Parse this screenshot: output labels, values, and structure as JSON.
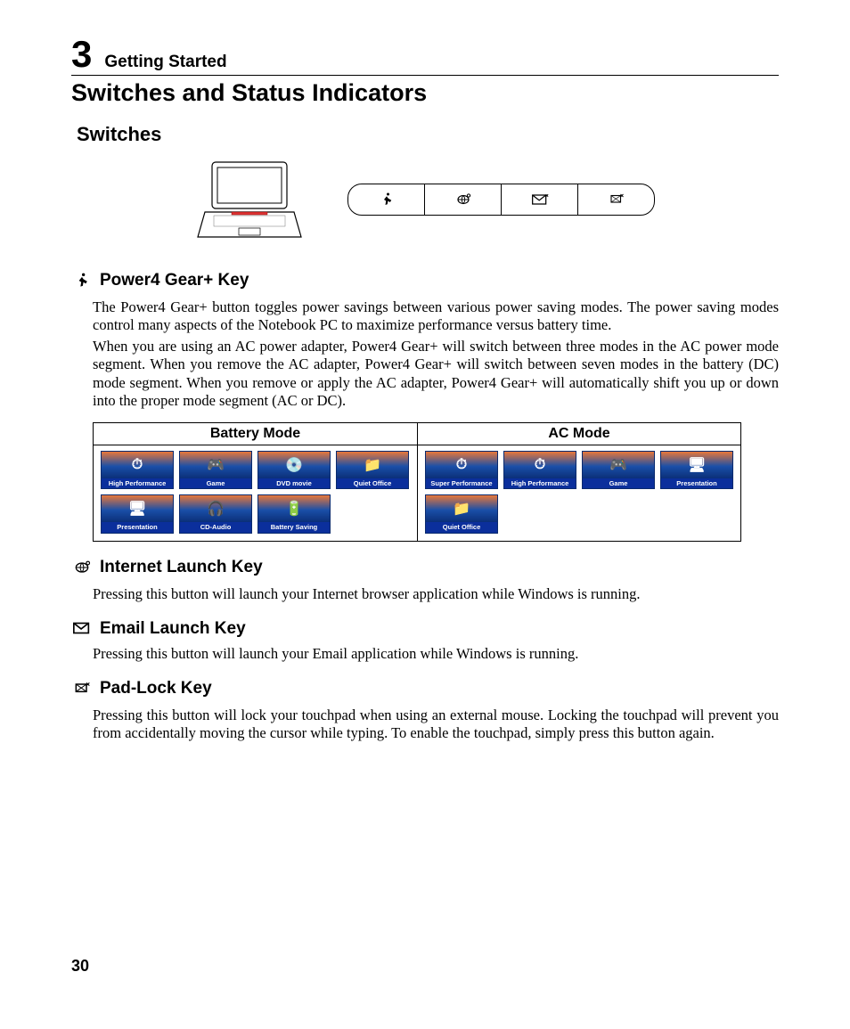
{
  "chapter": {
    "number": "3",
    "title": "Getting Started"
  },
  "pageTitle": "Switches and Status Indicators",
  "switches": {
    "heading": "Switches",
    "bar": [
      "running-man-icon",
      "globe-icon",
      "mail-icon",
      "padlock-icon"
    ]
  },
  "sections": {
    "power4": {
      "title": "Power4 Gear+ Key",
      "p1": "The Power4 Gear+ button toggles power savings between various power saving modes. The power saving modes control many aspects of the Notebook PC to maximize performance versus battery time.",
      "p2": "When you are using an AC power adapter, Power4 Gear+ will switch between three modes in the AC power mode segment. When you remove the AC adapter, Power4 Gear+ will switch between seven modes in the battery (DC) mode segment. When you remove or apply the AC adapter, Power4 Gear+ will automatically shift you up or down into the proper mode segment (AC or DC)."
    },
    "internet": {
      "title": "Internet Launch Key",
      "p1": "Pressing this button will launch your Internet browser application while Windows is running."
    },
    "email": {
      "title": "Email Launch Key",
      "p1": "Pressing this button will launch your Email application while Windows is running."
    },
    "padlock": {
      "title": "Pad-Lock Key",
      "p1": "Pressing this button will lock your touchpad when using an external mouse. Locking the touchpad will prevent you from accidentally moving the cursor while typing. To enable the touchpad, simply press this button again."
    }
  },
  "modeTable": {
    "headers": [
      "Battery Mode",
      "AC Mode"
    ],
    "battery": [
      {
        "label": "High Performance",
        "glyph": "⏱"
      },
      {
        "label": "Game",
        "glyph": "🎮"
      },
      {
        "label": "DVD movie",
        "glyph": "💿"
      },
      {
        "label": "Quiet Office",
        "glyph": "📁"
      },
      {
        "label": "Presentation",
        "glyph": "🖥"
      },
      {
        "label": "CD-Audio",
        "glyph": "🎧"
      },
      {
        "label": "Battery Saving",
        "glyph": "🔋"
      }
    ],
    "ac": [
      {
        "label": "Super Performance",
        "glyph": "⏱"
      },
      {
        "label": "High Performance",
        "glyph": "⏱"
      },
      {
        "label": "Game",
        "glyph": "🎮"
      },
      {
        "label": "Presentation",
        "glyph": "🖥"
      },
      {
        "label": "Quiet Office",
        "glyph": "📁"
      }
    ]
  },
  "pageNumber": "30"
}
